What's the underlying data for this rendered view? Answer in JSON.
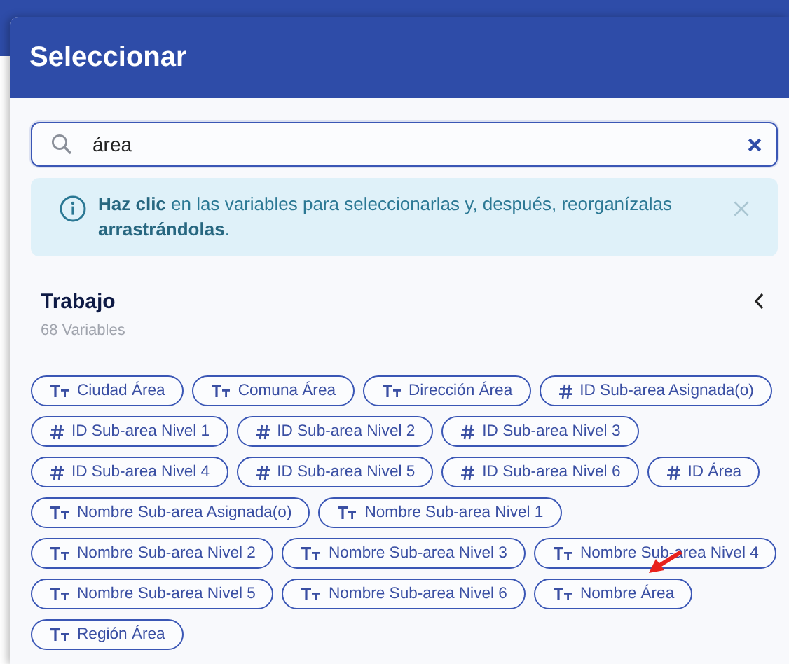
{
  "modal": {
    "title": "Seleccionar"
  },
  "search": {
    "value": "área"
  },
  "alert": {
    "text": "**Haz clic** en las variables para seleccionarlas y, después, reorganízalas **arrastrándolas**."
  },
  "section": {
    "title": "Trabajo",
    "subtitle": "68 Variables",
    "expanded": true
  },
  "variables": [
    {
      "label": "Ciudad Área",
      "kind": "text"
    },
    {
      "label": "Comuna Área",
      "kind": "text"
    },
    {
      "label": "Dirección Área",
      "kind": "text"
    },
    {
      "label": "ID Sub-area Asignada(o)",
      "kind": "number"
    },
    {
      "label": "ID Sub-area Nivel 1",
      "kind": "number"
    },
    {
      "label": "ID Sub-area Nivel 2",
      "kind": "number"
    },
    {
      "label": "ID Sub-area Nivel 3",
      "kind": "number"
    },
    {
      "label": "ID Sub-area Nivel 4",
      "kind": "number"
    },
    {
      "label": "ID Sub-area Nivel 5",
      "kind": "number"
    },
    {
      "label": "ID Sub-area Nivel 6",
      "kind": "number"
    },
    {
      "label": "ID Área",
      "kind": "number"
    },
    {
      "label": "Nombre Sub-area Asignada(o)",
      "kind": "text"
    },
    {
      "label": "Nombre Sub-area Nivel 1",
      "kind": "text"
    },
    {
      "label": "Nombre Sub-area Nivel 2",
      "kind": "text"
    },
    {
      "label": "Nombre Sub-area Nivel 3",
      "kind": "text"
    },
    {
      "label": "Nombre Sub-area Nivel 4",
      "kind": "text"
    },
    {
      "label": "Nombre Sub-area Nivel 5",
      "kind": "text"
    },
    {
      "label": "Nombre Sub-area Nivel 6",
      "kind": "text"
    },
    {
      "label": "Nombre Área",
      "kind": "text"
    },
    {
      "label": "Región Área",
      "kind": "text"
    }
  ]
}
